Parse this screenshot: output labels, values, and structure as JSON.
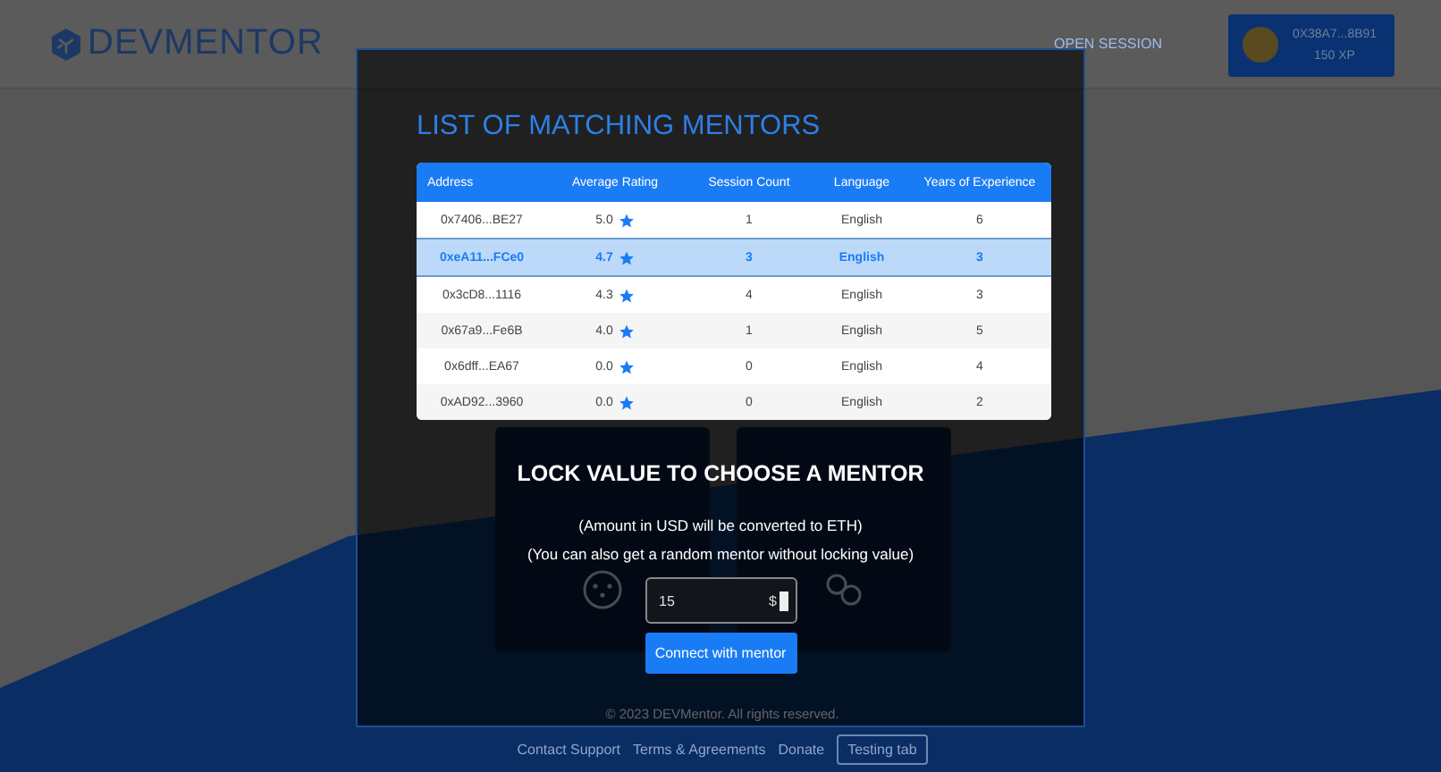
{
  "header": {
    "logo": "DEVMENTOR",
    "nav_link": "OPEN SESSION",
    "profile": {
      "address": "0X38A7...8B91",
      "xp": "150 XP"
    }
  },
  "background_cards": [
    {
      "kind": "random"
    },
    {
      "kind": "lock"
    }
  ],
  "footer": {
    "copyright": "© 2023 DEVMentor. All rights reserved.",
    "links": [
      {
        "label": "Contact Support",
        "kind": "plain"
      },
      {
        "label": "Terms & Agreements",
        "kind": "plain"
      },
      {
        "label": "Donate",
        "kind": "plain"
      },
      {
        "label": "Testing tab",
        "kind": "outlined"
      }
    ]
  },
  "modal": {
    "title": "LIST OF MATCHING MENTORS",
    "table": {
      "columns": [
        "Address",
        "Average Rating",
        "Session Count",
        "Language",
        "Years of Experience"
      ],
      "rows": [
        {
          "address": "0x7406...BE27",
          "rating": "5.0",
          "sessions": "1",
          "language": "English",
          "experience": "6",
          "selected": false
        },
        {
          "address": "0xeA11...FCe0",
          "rating": "4.7",
          "sessions": "3",
          "language": "English",
          "experience": "3",
          "selected": true
        },
        {
          "address": "0x3cD8...1116",
          "rating": "4.3",
          "sessions": "4",
          "language": "English",
          "experience": "3",
          "selected": false
        },
        {
          "address": "0x67a9...Fe6B",
          "rating": "4.0",
          "sessions": "1",
          "language": "English",
          "experience": "5",
          "selected": false
        },
        {
          "address": "0x6dff...EA67",
          "rating": "0.0",
          "sessions": "0",
          "language": "English",
          "experience": "4",
          "selected": false
        },
        {
          "address": "0xAD92...3960",
          "rating": "0.0",
          "sessions": "0",
          "language": "English",
          "experience": "2",
          "selected": false
        }
      ]
    },
    "lock": {
      "title": "LOCK VALUE TO CHOOSE A MENTOR",
      "notes": [
        "(Amount in USD will be converted to ETH)",
        "(You can also get a random mentor without locking value)"
      ],
      "amount": {
        "value": "15",
        "unit": "$"
      },
      "button": "Connect with mentor"
    }
  }
}
